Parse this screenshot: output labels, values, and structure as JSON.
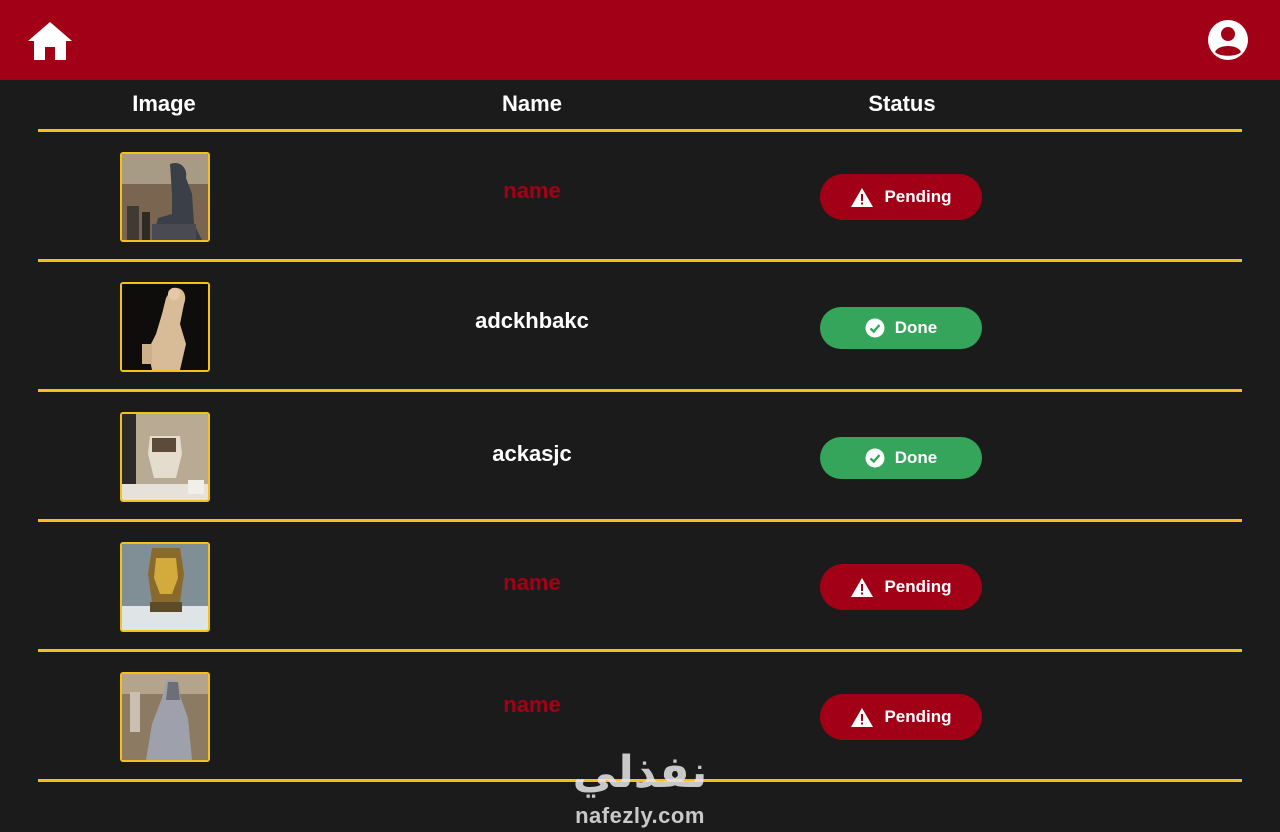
{
  "header": {
    "home_icon": "home-icon",
    "profile_icon": "account-circle-icon",
    "bar_color": "#a20016"
  },
  "table": {
    "columns": [
      "Image",
      "Name",
      "Status"
    ],
    "rule_color": "#f2c21b",
    "rows": [
      {
        "image": "seated-statue-thumbnail",
        "name": "name",
        "name_missing": true,
        "status": "Pending",
        "status_icon": "warning-icon"
      },
      {
        "image": "kneeling-statue-thumbnail",
        "name": "adckhbakc",
        "name_missing": false,
        "status": "Done",
        "status_icon": "check-circle-icon"
      },
      {
        "image": "canopic-jar-thumbnail",
        "name": "ackasjc",
        "name_missing": false,
        "status": "Done",
        "status_icon": "check-circle-icon"
      },
      {
        "image": "gold-mask-thumbnail",
        "name": "name",
        "name_missing": true,
        "status": "Pending",
        "status_icon": "warning-icon"
      },
      {
        "image": "grey-statue-thumbnail",
        "name": "name",
        "name_missing": true,
        "status": "Pending",
        "status_icon": "warning-icon"
      }
    ]
  },
  "status_colors": {
    "pending": "#a20016",
    "done": "#34a55a"
  },
  "watermark": {
    "arabic": "نفذلي",
    "latin": "nafezly.com"
  }
}
